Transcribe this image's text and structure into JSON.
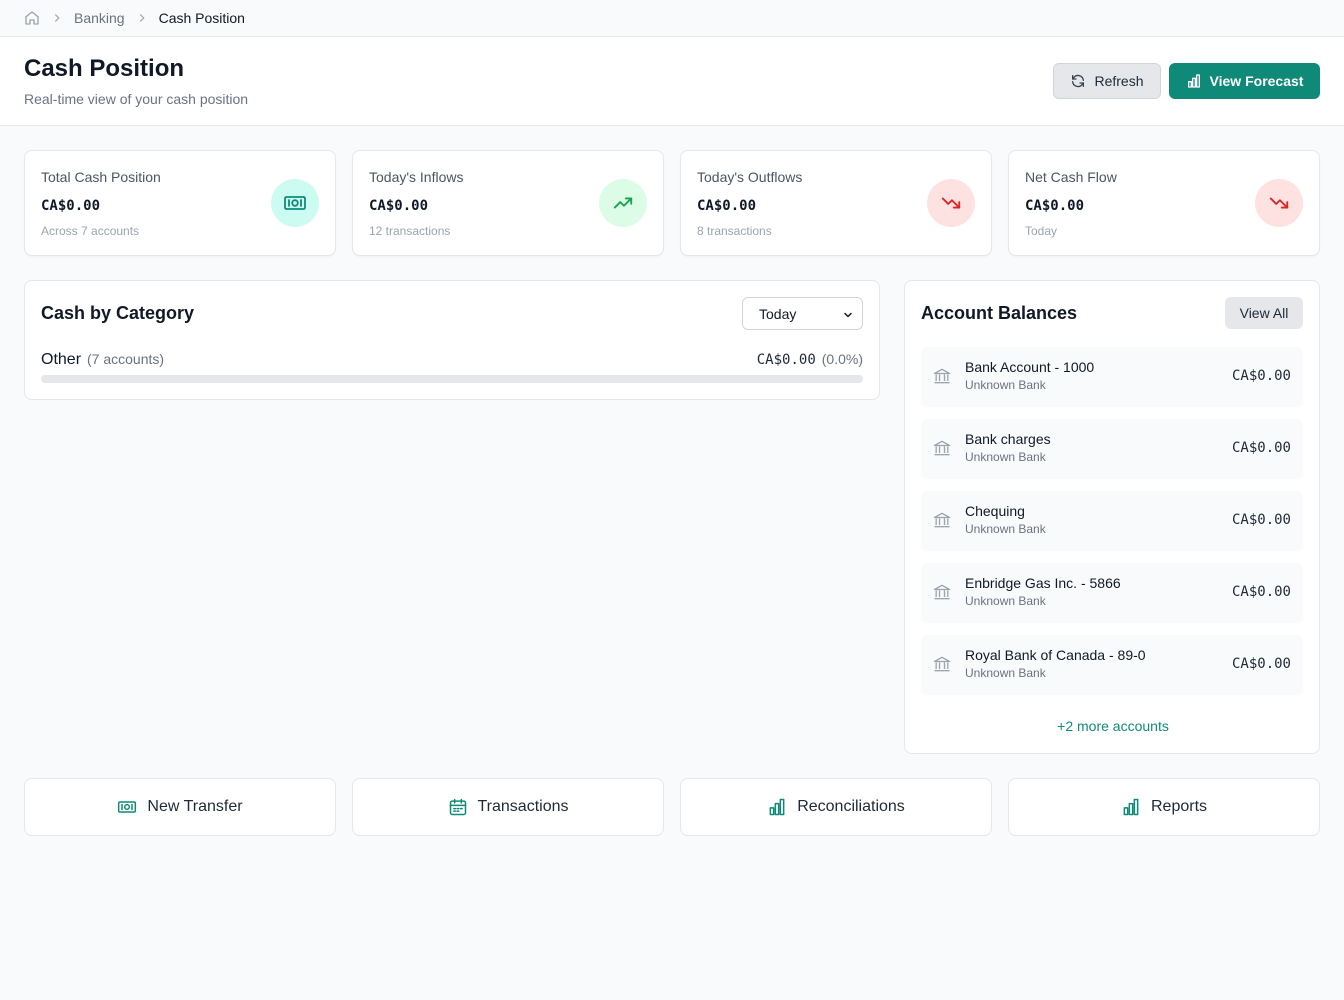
{
  "breadcrumb": {
    "home_icon": "home-icon",
    "items": [
      "Banking",
      "Cash Position"
    ]
  },
  "header": {
    "title": "Cash Position",
    "subtitle": "Real-time view of your cash position",
    "refresh_label": "Refresh",
    "forecast_label": "View Forecast"
  },
  "stats": [
    {
      "label": "Total Cash Position",
      "value": "CA$0.00",
      "sub": "Across 7 accounts",
      "icon": "cash-icon",
      "color": "#14b8a6"
    },
    {
      "label": "Today's Inflows",
      "value": "CA$0.00",
      "sub": "12 transactions",
      "icon": "trending-up-icon",
      "color": "#16a34a"
    },
    {
      "label": "Today's Outflows",
      "value": "CA$0.00",
      "sub": "8 transactions",
      "icon": "trending-down-icon",
      "color": "#dc2626"
    },
    {
      "label": "Net Cash Flow",
      "value": "CA$0.00",
      "sub": "Today",
      "icon": "trending-down-icon",
      "color": "#dc2626"
    }
  ],
  "category": {
    "title": "Cash by Category",
    "period": "Today",
    "rows": [
      {
        "name": "Other",
        "count": "(7 accounts)",
        "value": "CA$0.00",
        "pct": "(0.0%)",
        "fill": 0
      }
    ]
  },
  "accounts": {
    "title": "Account Balances",
    "view_all_label": "View All",
    "items": [
      {
        "name": "Bank Account - 1000",
        "bank": "Unknown Bank",
        "amount": "CA$0.00"
      },
      {
        "name": "Bank charges",
        "bank": "Unknown Bank",
        "amount": "CA$0.00"
      },
      {
        "name": "Chequing",
        "bank": "Unknown Bank",
        "amount": "CA$0.00"
      },
      {
        "name": "Enbridge Gas Inc. - 5866",
        "bank": "Unknown Bank",
        "amount": "CA$0.00"
      },
      {
        "name": "Royal Bank of Canada - 89-0",
        "bank": "Unknown Bank",
        "amount": "CA$0.00"
      }
    ],
    "more_label": "+2 more accounts"
  },
  "quick_actions": [
    {
      "label": "New Transfer",
      "icon": "cash-icon"
    },
    {
      "label": "Transactions",
      "icon": "calendar-icon"
    },
    {
      "label": "Reconciliations",
      "icon": "bar-chart-icon"
    },
    {
      "label": "Reports",
      "icon": "bar-chart-icon"
    }
  ],
  "colors": {
    "accent": "#0f8a78",
    "inflow_bg": "#dcfce7",
    "outflow_bg": "#fee2e2",
    "cash_bg": "#ccfbf1"
  }
}
